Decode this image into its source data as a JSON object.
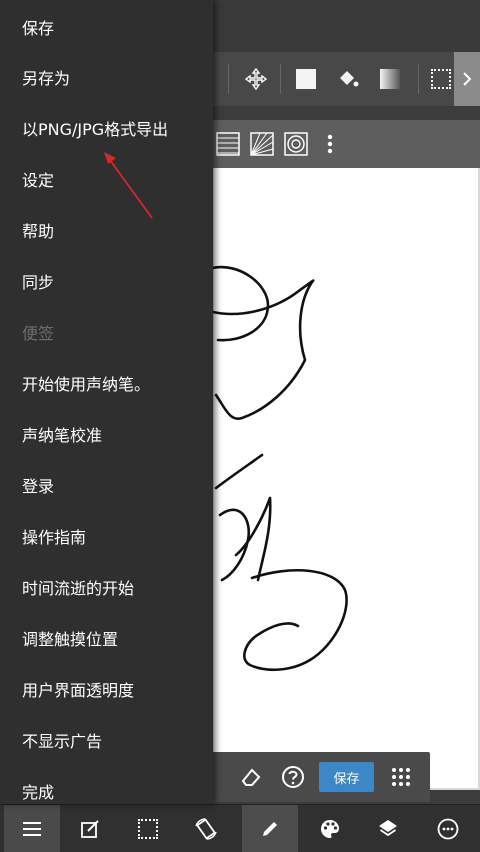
{
  "menu": {
    "items": [
      {
        "label": "保存",
        "enabled": true
      },
      {
        "label": "另存为",
        "enabled": true
      },
      {
        "label": "以PNG/JPG格式导出",
        "enabled": true
      },
      {
        "label": "设定",
        "enabled": true
      },
      {
        "label": "帮助",
        "enabled": true
      },
      {
        "label": "同步",
        "enabled": true
      },
      {
        "label": "便签",
        "enabled": false
      },
      {
        "label": "开始使用声纳笔。",
        "enabled": true
      },
      {
        "label": "声纳笔校准",
        "enabled": true
      },
      {
        "label": "登录",
        "enabled": true
      },
      {
        "label": "操作指南",
        "enabled": true
      },
      {
        "label": "时间流逝的开始",
        "enabled": true
      },
      {
        "label": "调整触摸位置",
        "enabled": true
      },
      {
        "label": "用户界面透明度",
        "enabled": true
      },
      {
        "label": "不显示广告",
        "enabled": true
      },
      {
        "label": "完成",
        "enabled": true
      }
    ]
  },
  "toolbar": {
    "icons": [
      "move-icon",
      "color-square-icon",
      "fill-bucket-icon",
      "gradient-icon",
      "selection-icon",
      "chevron-right-icon"
    ]
  },
  "subtoolbar": {
    "icons": [
      "concentric-line-ruler-icon",
      "radial-line-ruler-icon",
      "circle-ruler-icon",
      "more-vertical-icon"
    ]
  },
  "float_toolbar": {
    "icons": [
      "eraser-icon",
      "help-icon",
      "grid-icon"
    ],
    "save_label": "保存"
  },
  "bottom_bar": {
    "items": [
      "menu-icon",
      "edit-icon",
      "selection-icon",
      "rotate-icon",
      "pen-icon",
      "palette-icon",
      "layers-icon",
      "more-icon"
    ],
    "active": "pen-icon"
  },
  "colors": {
    "drawer_bg": "#2f2f2f",
    "disabled_text": "#6e6e6e",
    "save_button": "#3b87c8",
    "annotation_arrow": "#d42a2a"
  }
}
